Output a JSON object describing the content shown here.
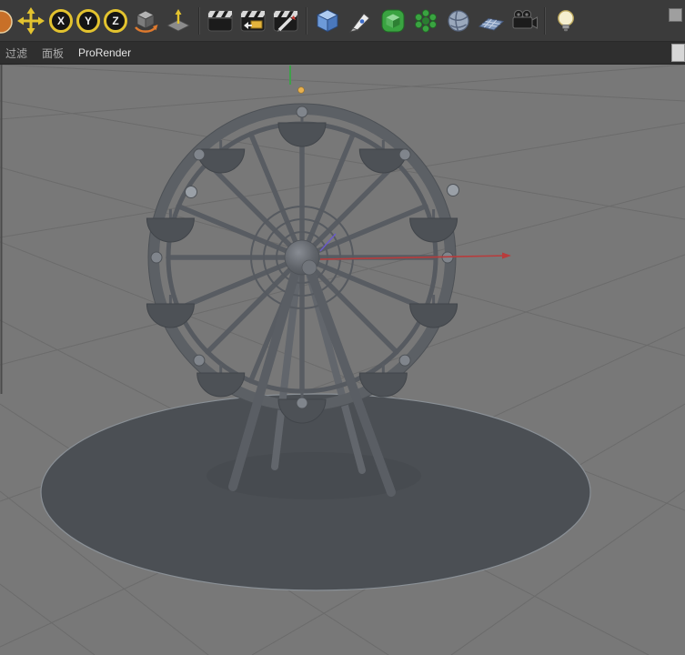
{
  "window": {
    "app": "3D viewport"
  },
  "toolbar": {
    "axis_locks": {
      "x": "X",
      "y": "Y",
      "z": "Z"
    },
    "icons": [
      "live-selection-tool-icon",
      "move-tool-icon",
      "lock-x-axis-button",
      "lock-y-axis-button",
      "lock-z-axis-button",
      "coordinate-system-icon",
      "workplane-icon",
      "render-view-icon",
      "render-picture-viewer-icon",
      "render-settings-icon",
      "add-cube-icon",
      "spline-pen-icon",
      "subdivision-surface-icon",
      "cloner-icon",
      "sphere-object-icon",
      "floor-icon",
      "camera-icon",
      "light-icon"
    ],
    "accent_yellow": "#e3c32f"
  },
  "menubar": {
    "items": [
      {
        "label": "过滤"
      },
      {
        "label": "面板"
      },
      {
        "label": "ProRender"
      }
    ]
  },
  "viewport": {
    "model": "ferris-wheel",
    "colors": {
      "background": "#787878",
      "grid_line": "#6b6b6b",
      "model_gray": "#5c6065",
      "gondola_gray": "#4d5156",
      "ground_disc": "#4b4f54",
      "axis_x_red": "#b83c3c",
      "axis_y_green": "#3fa04a"
    }
  }
}
